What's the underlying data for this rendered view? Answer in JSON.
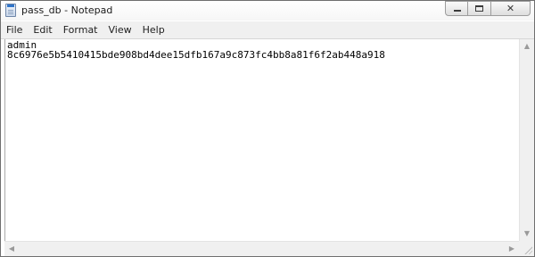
{
  "window": {
    "title": "pass_db - Notepad",
    "icon": "notepad-icon"
  },
  "caption_buttons": {
    "minimize_icon": "minimize-icon",
    "maximize_icon": "maximize-icon",
    "close_label": "✕"
  },
  "menu": [
    {
      "label": "File"
    },
    {
      "label": "Edit"
    },
    {
      "label": "Format"
    },
    {
      "label": "View"
    },
    {
      "label": "Help"
    }
  ],
  "editor": {
    "lines": [
      "admin",
      "8c6976e5b5410415bde908bd4dee15dfb167a9c873fc4bb8a81f6f2ab448a918"
    ]
  },
  "scrollbars": {
    "up_arrow": "▲",
    "down_arrow": "▼",
    "left_arrow": "◀",
    "right_arrow": "▶"
  }
}
